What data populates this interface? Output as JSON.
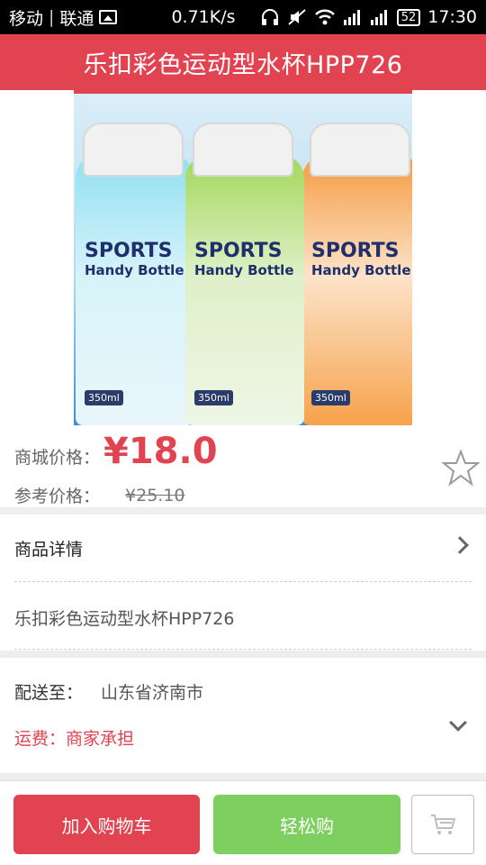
{
  "status_bar": {
    "carrier": "移动",
    "network": "联通",
    "speed": "0.71K/s",
    "battery": "52",
    "time": "17:30"
  },
  "title": "乐扣彩色运动型水杯HPP726",
  "product_image": {
    "label_line1": "SPORTS",
    "label_line2": "Handy Bottle",
    "volume": "350ml"
  },
  "price": {
    "label": "商城价格：",
    "value": "¥18.0",
    "ref_label": "参考价格：",
    "ref_value": "¥25.10"
  },
  "detail": {
    "label": "商品详情",
    "description": "乐扣彩色运动型水杯HPP726"
  },
  "shipping": {
    "label": "配送至：",
    "value": "山东省济南市",
    "fee": "运费：商家承担"
  },
  "buttons": {
    "add_to_cart": "加入购物车",
    "easy_buy": "轻松购"
  },
  "colors": {
    "accent": "#e14350",
    "buy_green": "#7dcf5f"
  }
}
